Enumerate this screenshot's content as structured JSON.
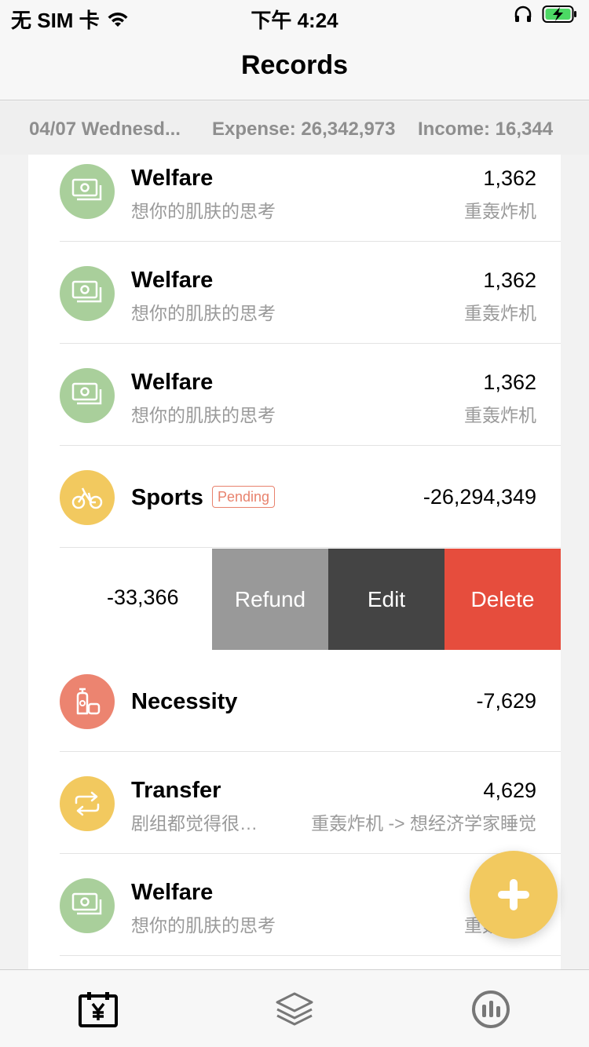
{
  "status_bar": {
    "carrier": "无 SIM 卡",
    "time": "下午 4:24"
  },
  "nav": {
    "title": "Records"
  },
  "summary": {
    "date": "04/07 Wednesd...",
    "expense": "Expense: 26,342,973",
    "income": "Income: 16,344"
  },
  "records": [
    {
      "name": "Welfare",
      "note": "想你的肌肤的思考",
      "amount": "1,362",
      "account": "重轰炸机",
      "icon": "cash-icon",
      "color": "#a9cf9b"
    },
    {
      "name": "Welfare",
      "note": "想你的肌肤的思考",
      "amount": "1,362",
      "account": "重轰炸机",
      "icon": "cash-icon",
      "color": "#a9cf9b"
    },
    {
      "name": "Welfare",
      "note": "想你的肌肤的思考",
      "amount": "1,362",
      "account": "重轰炸机",
      "icon": "cash-icon",
      "color": "#a9cf9b"
    },
    {
      "name": "Sports",
      "badge": "Pending",
      "amount": "-26,294,349",
      "icon": "bicycle-icon",
      "color": "#f2c95f"
    },
    {
      "swiped_amount": "-33,366"
    },
    {
      "name": "Necessity",
      "amount": "-7,629",
      "icon": "bottle-icon",
      "color": "#ec8470"
    },
    {
      "name": "Transfer",
      "note": "剧组都觉得很…",
      "amount": "4,629",
      "account": "重轰炸机 -> 想经济学家睡觉",
      "icon": "transfer-icon",
      "color": "#f2c95f"
    },
    {
      "name": "Welfare",
      "note": "想你的肌肤的思考",
      "account": "重轰炸机",
      "icon": "cash-icon",
      "color": "#a9cf9b"
    }
  ],
  "swipe_actions": {
    "refund": "Refund",
    "edit": "Edit",
    "delete": "Delete",
    "refund_color": "#999999",
    "edit_color": "#444444",
    "delete_color": "#e64d3d"
  },
  "fab": {
    "icon": "plus-icon",
    "color": "#f2c95f"
  },
  "tab_bar": {
    "items": [
      {
        "icon": "calendar-yen-icon",
        "active": true
      },
      {
        "icon": "layers-icon",
        "active": false
      },
      {
        "icon": "stats-icon",
        "active": false
      }
    ]
  }
}
